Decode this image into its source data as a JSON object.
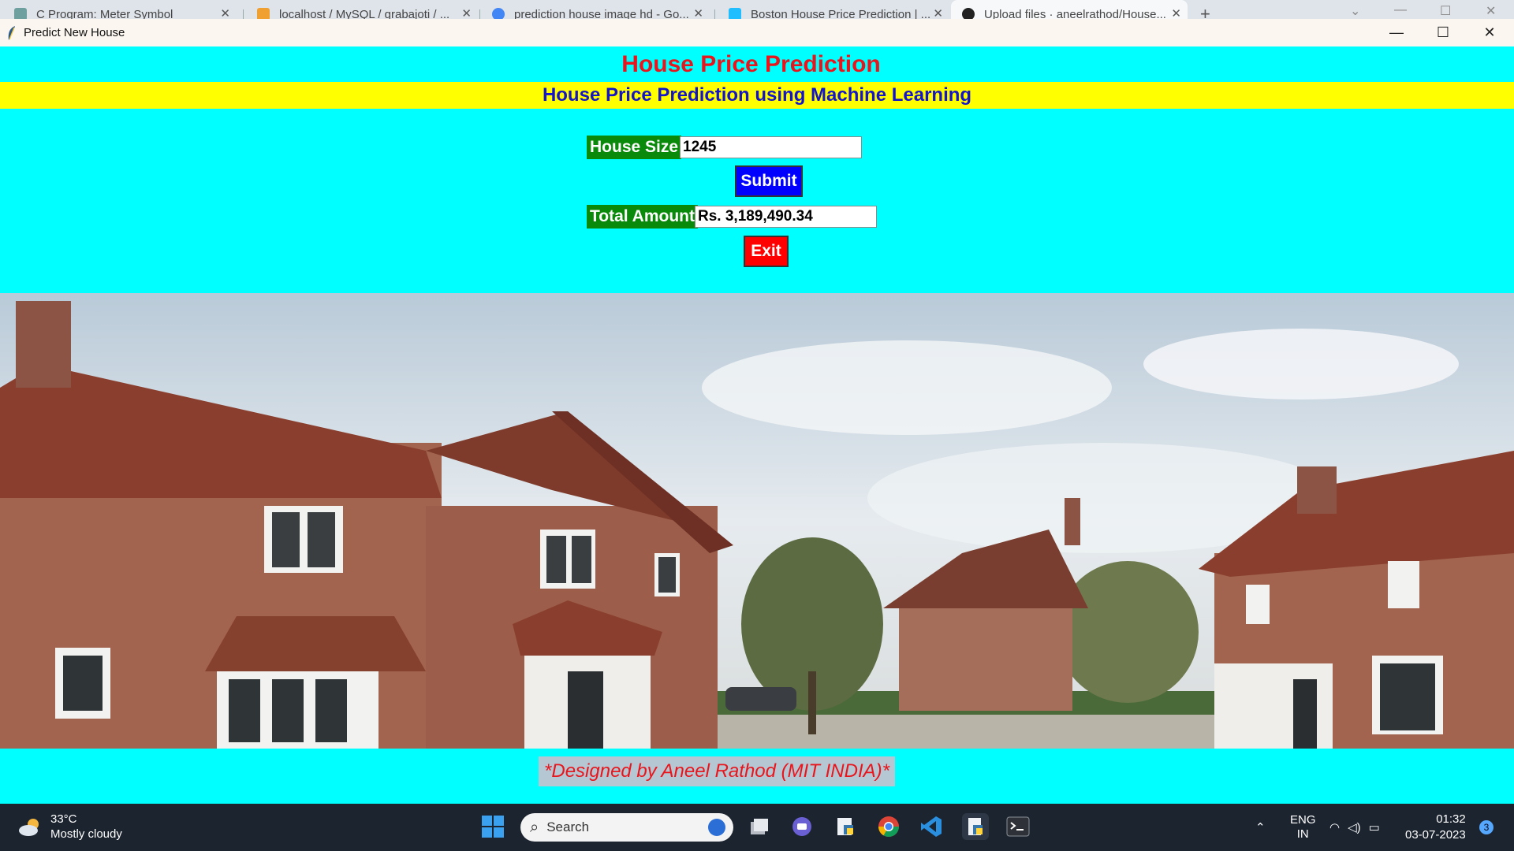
{
  "browser": {
    "tabs": [
      {
        "label": "C Program: Meter Symbol",
        "icon": "c-program-site-icon"
      },
      {
        "label": "localhost / MySQL / grabajoti / ...",
        "icon": "phpmyadmin-icon"
      },
      {
        "label": "prediction house image hd - Go...",
        "icon": "google-icon"
      },
      {
        "label": "Boston House Price Prediction | ...",
        "icon": "kaggle-icon"
      },
      {
        "label": "Upload files · aneelrathod/House...",
        "icon": "github-icon"
      }
    ]
  },
  "window": {
    "title": "Predict New House",
    "controls": {
      "minimize": "—",
      "maximize": "☐",
      "close": "✕"
    }
  },
  "app": {
    "title": "House Price Prediction",
    "subtitle": "House Price Prediction using Machine Learning",
    "house_size_label": "House Size",
    "house_size_value": "1245",
    "submit_label": "Submit",
    "total_amount_label": "Total Amount",
    "total_amount_value": "Rs. 3,189,490.34",
    "exit_label": "Exit",
    "credit": "*Designed by Aneel Rathod (MIT INDIA)*",
    "colors": {
      "background": "#00ffff",
      "title": "#e8161c",
      "banner": "#ffff00",
      "label_bg": "#0a8a0a",
      "submit": "#0000ff",
      "exit": "#ff0000"
    }
  },
  "taskbar": {
    "weather_temp": "33°C",
    "weather_desc": "Mostly cloudy",
    "search_placeholder": "Search",
    "apps": [
      "windows-start-icon",
      "task-view-icon",
      "teams-chat-icon",
      "file-explorer-icon",
      "chrome-icon",
      "vscode-icon",
      "python-idle-icon",
      "terminal-icon"
    ],
    "lang_1": "ENG",
    "lang_2": "IN",
    "time": "01:32",
    "date": "03-07-2023",
    "notifications": "3"
  }
}
